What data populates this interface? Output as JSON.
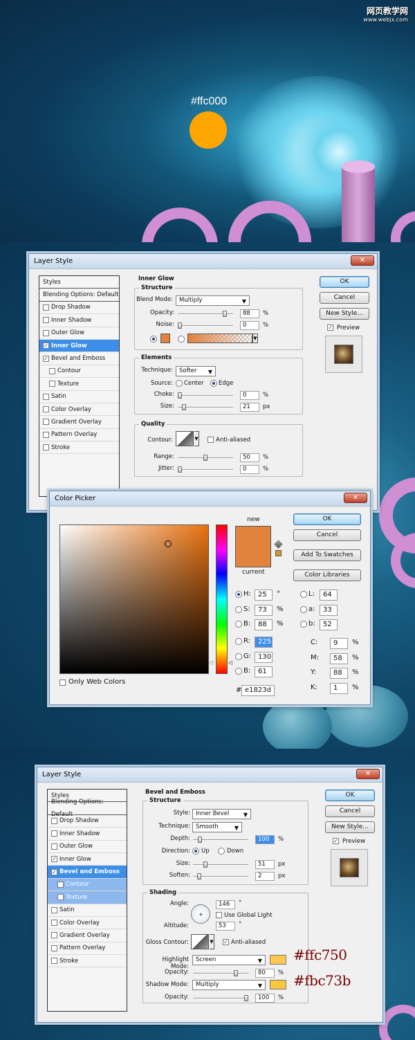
{
  "watermark": {
    "title": "网页教学网",
    "url": "www.webjx.com"
  },
  "scene1": {
    "color_label": "#ffc000",
    "swatch_color": "#ffa500"
  },
  "annotations": {
    "highlight_hex": "#ffc750",
    "shadow_hex": "#fbc73b"
  },
  "layer_style_1": {
    "title": "Layer Style",
    "style_list": [
      {
        "label": "Styles",
        "checkbox": false,
        "checked": false,
        "state": "head"
      },
      {
        "label": "Blending Options: Default",
        "checkbox": false,
        "checked": false,
        "state": "head"
      },
      {
        "label": "Drop Shadow",
        "checkbox": true,
        "checked": false,
        "state": ""
      },
      {
        "label": "Inner Shadow",
        "checkbox": true,
        "checked": false,
        "state": ""
      },
      {
        "label": "Outer Glow",
        "checkbox": true,
        "checked": false,
        "state": ""
      },
      {
        "label": "Inner Glow",
        "checkbox": true,
        "checked": true,
        "state": "sel"
      },
      {
        "label": "Bevel and Emboss",
        "checkbox": true,
        "checked": true,
        "state": ""
      },
      {
        "label": "Contour",
        "checkbox": true,
        "checked": false,
        "state": "sub"
      },
      {
        "label": "Texture",
        "checkbox": true,
        "checked": false,
        "state": "sub"
      },
      {
        "label": "Satin",
        "checkbox": true,
        "checked": false,
        "state": ""
      },
      {
        "label": "Color Overlay",
        "checkbox": true,
        "checked": false,
        "state": ""
      },
      {
        "label": "Gradient Overlay",
        "checkbox": true,
        "checked": false,
        "state": ""
      },
      {
        "label": "Pattern Overlay",
        "checkbox": true,
        "checked": false,
        "state": ""
      },
      {
        "label": "Stroke",
        "checkbox": true,
        "checked": false,
        "state": ""
      }
    ],
    "section_title": "Inner Glow",
    "structure": {
      "legend": "Structure",
      "blend_mode_label": "Blend Mode:",
      "blend_mode": "Multiply",
      "opacity_label": "Opacity:",
      "opacity": "88",
      "opacity_level": 0.88,
      "noise_label": "Noise:",
      "noise": "0",
      "noise_level": 0,
      "glow_color": "#e1823d"
    },
    "elements": {
      "legend": "Elements",
      "technique_label": "Technique:",
      "technique": "Softer",
      "source_label": "Source:",
      "source_center": "Center",
      "source_edge": "Edge",
      "choke_label": "Choke:",
      "choke": "0",
      "choke_level": 0,
      "size_label": "Size:",
      "size": "21",
      "size_level": 0.08,
      "size_unit": "px"
    },
    "quality": {
      "legend": "Quality",
      "contour_label": "Contour:",
      "anti_aliased": "Anti-aliased",
      "range_label": "Range:",
      "range": "50",
      "range_level": 0.5,
      "jitter_label": "Jitter:",
      "jitter": "0",
      "jitter_level": 0
    },
    "percent": "%",
    "buttons": {
      "ok": "OK",
      "cancel": "Cancel",
      "new_style": "New Style...",
      "preview": "Preview"
    }
  },
  "color_picker": {
    "title": "Color Picker",
    "new_label": "new",
    "current_label": "current",
    "new_color": "#e1823d",
    "current_color": "#e1823d",
    "only_web_colors": "Only Web Colors",
    "buttons": {
      "ok": "OK",
      "cancel": "Cancel",
      "add_to_swatches": "Add To Swatches",
      "color_libraries": "Color Libraries"
    },
    "hsb": [
      {
        "label": "H:",
        "value": "25",
        "unit": "°"
      },
      {
        "label": "S:",
        "value": "73",
        "unit": "%"
      },
      {
        "label": "B:",
        "value": "88",
        "unit": "%"
      }
    ],
    "rgb": [
      {
        "label": "R:",
        "value": "225"
      },
      {
        "label": "G:",
        "value": "130"
      },
      {
        "label": "B:",
        "value": "61"
      }
    ],
    "lab": [
      {
        "label": "L:",
        "value": "64"
      },
      {
        "label": "a:",
        "value": "33"
      },
      {
        "label": "b:",
        "value": "52"
      }
    ],
    "cmyk": [
      {
        "label": "C:",
        "value": "9",
        "unit": "%"
      },
      {
        "label": "M:",
        "value": "58",
        "unit": "%"
      },
      {
        "label": "Y:",
        "value": "88",
        "unit": "%"
      },
      {
        "label": "K:",
        "value": "1",
        "unit": "%"
      }
    ],
    "hex_label": "#",
    "hex": "e1823d"
  },
  "layer_style_2": {
    "title": "Layer Style",
    "style_list": [
      {
        "label": "Styles",
        "checkbox": false,
        "checked": false,
        "state": "head"
      },
      {
        "label": "Blending Options: Default",
        "checkbox": false,
        "checked": false,
        "state": "head"
      },
      {
        "label": "Drop Shadow",
        "checkbox": true,
        "checked": false,
        "state": ""
      },
      {
        "label": "Inner Shadow",
        "checkbox": true,
        "checked": false,
        "state": ""
      },
      {
        "label": "Outer Glow",
        "checkbox": true,
        "checked": false,
        "state": ""
      },
      {
        "label": "Inner Glow",
        "checkbox": true,
        "checked": true,
        "state": ""
      },
      {
        "label": "Bevel and Emboss",
        "checkbox": true,
        "checked": true,
        "state": "sel"
      },
      {
        "label": "Contour",
        "checkbox": true,
        "checked": false,
        "state": "subsel"
      },
      {
        "label": "Texture",
        "checkbox": true,
        "checked": false,
        "state": "subsel"
      },
      {
        "label": "Satin",
        "checkbox": true,
        "checked": false,
        "state": ""
      },
      {
        "label": "Color Overlay",
        "checkbox": true,
        "checked": false,
        "state": ""
      },
      {
        "label": "Gradient Overlay",
        "checkbox": true,
        "checked": false,
        "state": ""
      },
      {
        "label": "Pattern Overlay",
        "checkbox": true,
        "checked": false,
        "state": ""
      },
      {
        "label": "Stroke",
        "checkbox": true,
        "checked": false,
        "state": ""
      }
    ],
    "section_title": "Bevel and Emboss",
    "structure": {
      "legend": "Structure",
      "style_label": "Style:",
      "style": "Inner Bevel",
      "technique_label": "Technique:",
      "technique": "Smooth",
      "depth_label": "Depth:",
      "depth": "100",
      "depth_level": 0.1,
      "depth_unit": "%",
      "direction_label": "Direction:",
      "direction_up": "Up",
      "direction_down": "Down",
      "size_label": "Size:",
      "size": "51",
      "size_level": 0.2,
      "size_unit": "px",
      "soften_label": "Soften:",
      "soften": "2",
      "soften_level": 0.08,
      "soften_unit": "px"
    },
    "shading": {
      "legend": "Shading",
      "angle_label": "Angle:",
      "angle": "146",
      "angle_unit": "°",
      "use_global_light": "Use Global Light",
      "altitude_label": "Altitude:",
      "altitude": "53",
      "altitude_unit": "°",
      "gloss_contour_label": "Gloss Contour:",
      "anti_aliased": "Anti-aliased",
      "highlight_mode_label": "Highlight Mode:",
      "highlight_mode": "Screen",
      "highlight_color": "#ffc750",
      "opacity1_label": "Opacity:",
      "opacity1": "80",
      "opacity1_level": 0.8,
      "opacity1_unit": "%",
      "shadow_mode_label": "Shadow Mode:",
      "shadow_mode": "Multiply",
      "shadow_color": "#fbc73b",
      "opacity2_label": "Opacity:",
      "opacity2": "100",
      "opacity2_level": 1.0,
      "opacity2_unit": "%"
    },
    "buttons": {
      "ok": "OK",
      "cancel": "Cancel",
      "new_style": "New Style...",
      "preview": "Preview"
    }
  }
}
